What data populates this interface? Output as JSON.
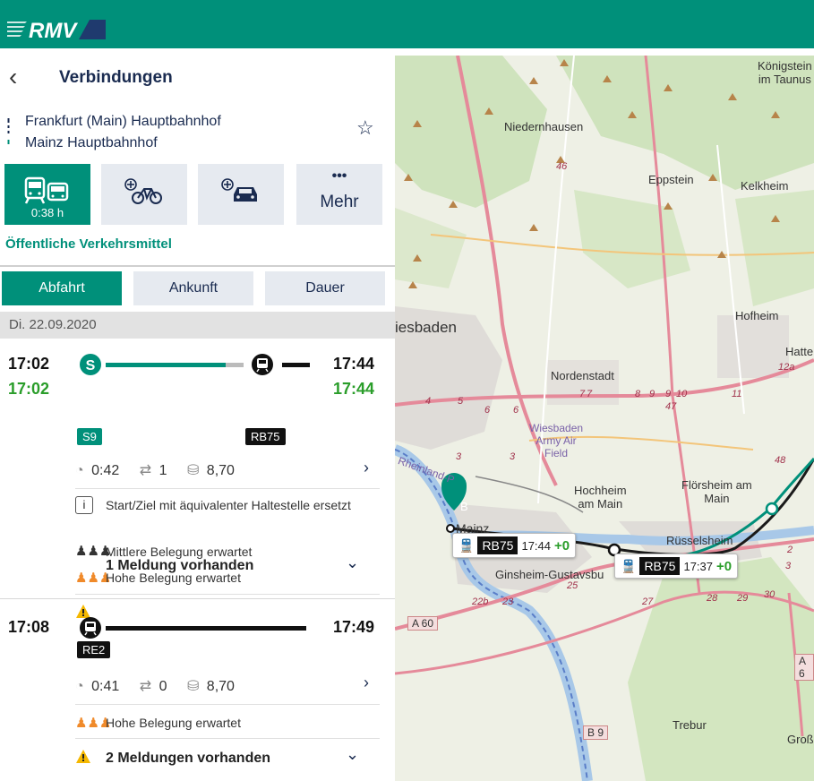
{
  "header": {
    "brand": "RMV"
  },
  "page": {
    "title": "Verbindungen"
  },
  "route": {
    "from": "Frankfurt (Main) Hauptbahnhof",
    "to": "Mainz Hauptbahnhof"
  },
  "modes": [
    {
      "name": "public-transport",
      "label": "0:38 h",
      "active": true
    },
    {
      "name": "bike",
      "label": "",
      "active": false
    },
    {
      "name": "car",
      "label": "",
      "active": false
    },
    {
      "name": "more",
      "label": "Mehr",
      "active": false
    }
  ],
  "mode_title": "Öffentliche Verkehrsmittel",
  "tabs": {
    "departure": "Abfahrt",
    "arrival": "Ankunft",
    "duration": "Dauer"
  },
  "date": "Di. 22.09.2020",
  "connections": [
    {
      "dep_plan": "17:02",
      "dep_real": "17:02",
      "arr_plan": "17:44",
      "arr_real": "17:44",
      "line1": "S9",
      "line2": "RB75",
      "duration": "0:42",
      "changes": "1",
      "price": "8,70",
      "info_text": "Start/Ziel mit äquivalenter Haltestelle ersetzt",
      "occupancy_1": "Mittlere Belegung erwartet",
      "occupancy_2": "Hohe Belegung erwartet",
      "messages": "1 Meldung vorhanden"
    },
    {
      "dep_plan": "17:08",
      "arr_plan": "17:49",
      "line1": "RE2",
      "duration": "0:41",
      "changes": "0",
      "price": "8,70",
      "occupancy_1": "Hohe Belegung erwartet",
      "messages": "2 Meldungen vorhanden"
    }
  ],
  "map": {
    "labels": {
      "koenigstein": "Königstein\nim Taunus",
      "niedernhausen": "Niedernhausen",
      "eppstein": "Eppstein",
      "kelkheim": "Kelkheim",
      "wiesbaden": "iesbaden",
      "hofheim": "Hofheim",
      "hatte": "Hatte",
      "nordenstadt": "Nordenstadt",
      "airfield": "Wiesbaden\nArmy Air\nField",
      "hochheim": "Hochheim\nam Main",
      "floersheim": "Flörsheim am\nMain",
      "ruesselsheim": "Rüsselsheim",
      "mainz": "Mainz",
      "ginsheim": "Ginsheim-Gustavsbu",
      "trebur": "Trebur",
      "gross": "Groß",
      "rhein": "Rheinland-P"
    },
    "marker_b": "B",
    "bubble1": {
      "line": "RB75",
      "time": "17:44",
      "delay": "+0"
    },
    "bubble2": {
      "line": "RB75",
      "time": "17:37",
      "delay": "+0"
    },
    "shields": {
      "a60": "A 60",
      "b9": "B 9",
      "a6": "A 6"
    },
    "roads": [
      "46",
      "4",
      "5",
      "6",
      "6",
      "7",
      "7",
      "8",
      "9",
      "9",
      "10",
      "11",
      "47",
      "12a",
      "48",
      "3",
      "3",
      "22b",
      "23",
      "25",
      "27",
      "28",
      "29",
      "30",
      "2",
      "3"
    ]
  }
}
